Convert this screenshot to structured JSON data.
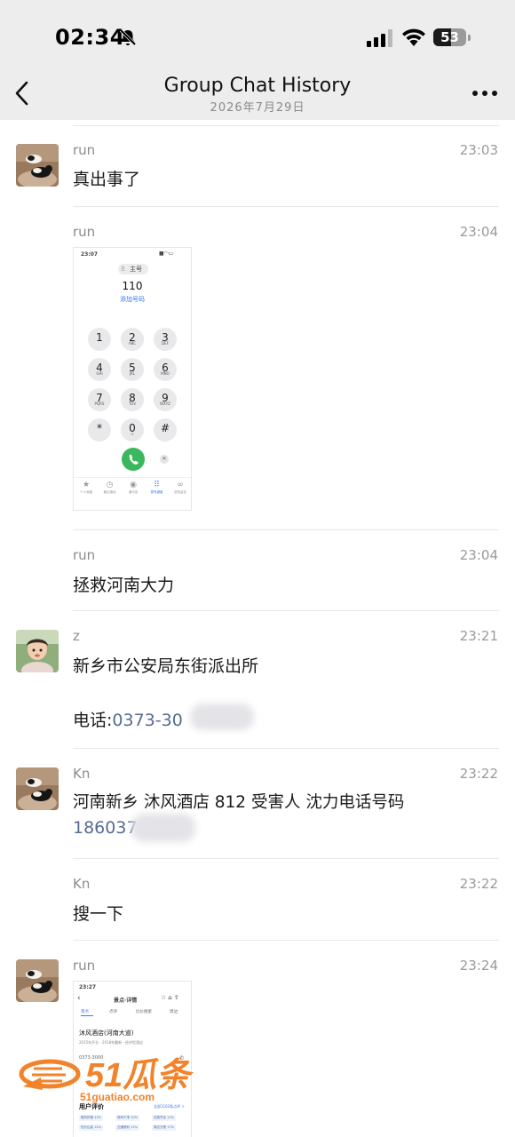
{
  "status_bar": {
    "time": "02:34",
    "battery": "53",
    "battery_level": 0.53
  },
  "nav": {
    "title": "Group Chat History",
    "subtitle": "2026年7月29日"
  },
  "messages": [
    {
      "sender": "run",
      "time": "23:03",
      "text": "真出事了"
    },
    {
      "sender": "run",
      "time": "23:04",
      "type": "image"
    },
    {
      "sender": "run",
      "time": "23:04",
      "text": "拯救河南大力"
    },
    {
      "sender": "z",
      "time": "23:21",
      "text": "新乡市公安局东街派出所",
      "phone_label": "电话:",
      "phone": "0373-30"
    },
    {
      "sender": "Kn",
      "time": "23:22",
      "text": "河南新乡 沐风酒店 812 受害人 沈力电话号码",
      "phone": "186037"
    },
    {
      "sender": "Kn",
      "time": "23:22",
      "text": "搜一下"
    },
    {
      "sender": "run",
      "time": "23:24",
      "type": "image"
    }
  ],
  "dialer_shot": {
    "time": "23:07",
    "sim_label": "主号",
    "sim_tag": "主",
    "number": "110",
    "add_label": "添加号码",
    "keys": [
      {
        "digit": "1",
        "letters": ""
      },
      {
        "digit": "2",
        "letters": "ABC"
      },
      {
        "digit": "3",
        "letters": "DEF"
      },
      {
        "digit": "4",
        "letters": "GHI"
      },
      {
        "digit": "5",
        "letters": "JKL"
      },
      {
        "digit": "6",
        "letters": "MNO"
      },
      {
        "digit": "7",
        "letters": "PQRS"
      },
      {
        "digit": "8",
        "letters": "TUV"
      },
      {
        "digit": "9",
        "letters": "WXYZ"
      },
      {
        "digit": "*",
        "letters": ""
      },
      {
        "digit": "0",
        "letters": "+"
      },
      {
        "digit": "#",
        "letters": ""
      }
    ],
    "tabs": [
      "个人收藏",
      "最近通话",
      "通讯录",
      "拨号键盘",
      "语音留言"
    ]
  },
  "hotel_shot": {
    "time": "23:27",
    "title": "景点·详情",
    "tabs": [
      "景点",
      "点评",
      "比价搜索",
      "周边"
    ],
    "name": "沐风酒店(河南大道)",
    "meta": "2015年开业 · 2018年翻新 · 经济型酒店",
    "phone": "0373-3000",
    "section": "用户评价",
    "section_more": "全部1163条点评 >",
    "tags": [
      "服务热情 13%",
      "房间干净 10%",
      "设施齐全 11%",
      "性价比高 12%",
      "交通便利 11%",
      "周边方便 17%"
    ]
  },
  "watermark": {
    "brand": "51瓜条",
    "url": "51guatiao.com"
  },
  "colors": {
    "link": "#576b95",
    "nav_bg": "#ededed",
    "call_green": "#3bb75d",
    "watermark": "#f2832b"
  }
}
